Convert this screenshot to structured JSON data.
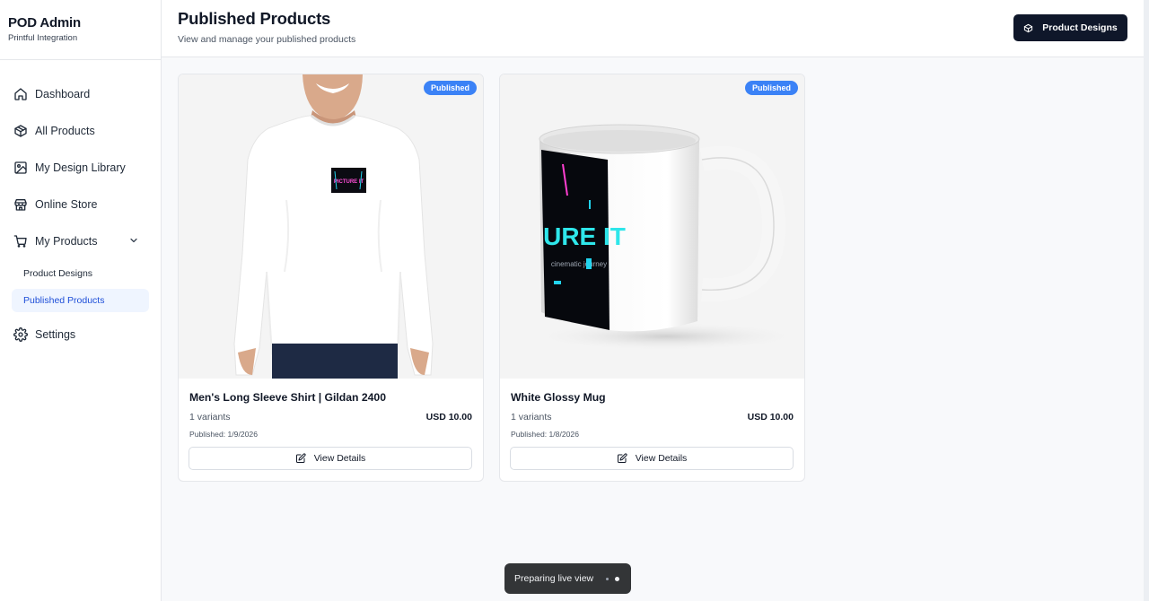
{
  "brand": {
    "title": "POD Admin",
    "subtitle": "Printful Integration"
  },
  "sidebar": {
    "items": [
      {
        "label": "Dashboard",
        "icon": "home-icon"
      },
      {
        "label": "All Products",
        "icon": "box-icon"
      },
      {
        "label": "My Design Library",
        "icon": "image-icon"
      },
      {
        "label": "Online Store",
        "icon": "store-icon"
      },
      {
        "label": "My Products",
        "icon": "cart-icon"
      },
      {
        "label": "Settings",
        "icon": "gear-icon"
      }
    ],
    "submenu": [
      {
        "label": "Product Designs",
        "active": false
      },
      {
        "label": "Published Products",
        "active": true
      }
    ]
  },
  "header": {
    "title": "Published Products",
    "subtitle": "View and manage your published products",
    "button_label": "Product Designs"
  },
  "products": [
    {
      "title": "Men's Long Sleeve Shirt | Gildan 2400",
      "badge": "Published",
      "variants": "1 variants",
      "price": "USD 10.00",
      "published": "Published: 1/9/2026",
      "button": "View Details",
      "print_text": "PICTURE IT"
    },
    {
      "title": "White Glossy Mug",
      "badge": "Published",
      "variants": "1 variants",
      "price": "USD 10.00",
      "published": "Published: 1/8/2026",
      "button": "View Details",
      "print_text": "URE IT",
      "print_subtext": "cinematic journey"
    }
  ],
  "toast": {
    "label": "Preparing live view"
  },
  "colors": {
    "accent": "#3b82f6",
    "primary_button": "#0f172a",
    "active_bg": "#eff5ff",
    "active_text": "#1d4ed8"
  }
}
